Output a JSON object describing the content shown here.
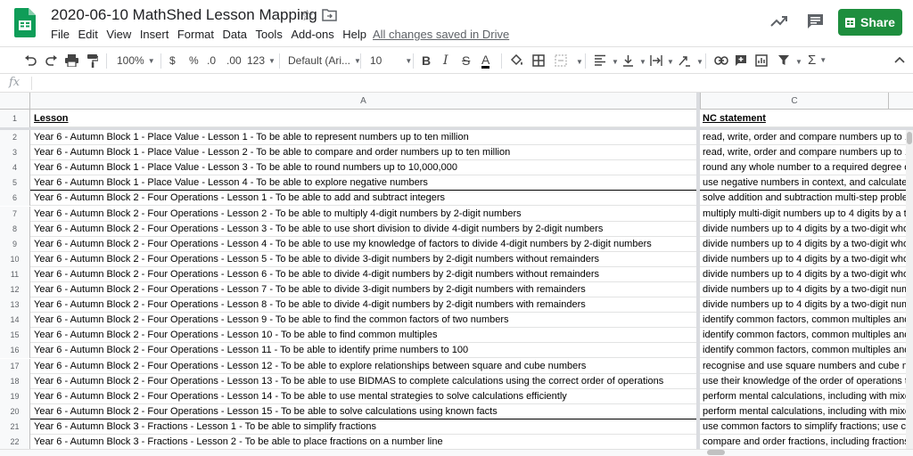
{
  "app": {
    "title": "2020-06-10 MathShed Lesson Mapping",
    "save_status": "All changes saved in Drive",
    "share_label": "Share",
    "brand_color": "#1e8e3e",
    "sheets_green": "#0f9d58"
  },
  "menu": [
    "File",
    "Edit",
    "View",
    "Insert",
    "Format",
    "Data",
    "Tools",
    "Add-ons",
    "Help"
  ],
  "toolbar": {
    "zoom": "100%",
    "currency": "$",
    "percent": "%",
    "dec_decrease": ".0",
    "dec_increase": ".00",
    "more_formats": "123",
    "font": "Default (Ari...",
    "font_size": "10",
    "bold": "B",
    "italic": "I",
    "strike": "S",
    "text_color": "A",
    "functions": "Σ"
  },
  "formula_bar": {
    "fx": "fx",
    "value": ""
  },
  "columns": {
    "a": "A",
    "c": "C"
  },
  "header": {
    "row": "1",
    "lesson": "Lesson",
    "nc": "NC statement"
  },
  "rows": [
    {
      "n": "2",
      "a": "Year 6 - Autumn Block 1 - Place Value - Lesson 1 - To be able to represent numbers up to ten million",
      "c": "read, write, order and compare numbers up to 10"
    },
    {
      "n": "3",
      "a": "Year 6 - Autumn Block 1 - Place Value - Lesson 2 - To be able to compare and order numbers up to ten million",
      "c": "read, write, order and compare numbers up to 10"
    },
    {
      "n": "4",
      "a": "Year 6 - Autumn Block 1 - Place Value - Lesson 3 - To be able to round numbers up to 10,000,000",
      "c": "round any whole number to a required degree of"
    },
    {
      "n": "5",
      "a": "Year 6 - Autumn Block 1 - Place Value - Lesson 4 - To be able to explore negative numbers",
      "c": "use negative numbers in context, and calculate i"
    },
    {
      "n": "6",
      "a": "Year 6 - Autumn Block 2 - Four Operations - Lesson 1 - To be able to add and subtract integers",
      "c": "solve addition and subtraction multi-step problen"
    },
    {
      "n": "7",
      "a": "Year 6 - Autumn Block 2 - Four Operations - Lesson 2 - To be able to multiply 4-digit numbers by 2-digit numbers",
      "c": "multiply multi-digit numbers up to 4 digits by a tw"
    },
    {
      "n": "8",
      "a": "Year 6 - Autumn Block 2 - Four Operations - Lesson 3 - To be able to use short division to divide 4-digit numbers by 2-digit numbers",
      "c": "divide numbers up to 4 digits by a two-digit whol"
    },
    {
      "n": "9",
      "a": "Year 6 - Autumn Block 2 - Four Operations - Lesson 4 - To be able to use my knowledge of factors to divide 4-digit numbers by 2-digit numbers",
      "c": "divide numbers up to 4 digits by a two-digit whol"
    },
    {
      "n": "10",
      "a": "Year 6 - Autumn Block 2 - Four Operations - Lesson 5 - To be able to divide 3-digit numbers by 2-digit numbers without remainders",
      "c": "divide numbers up to 4 digits by a two-digit whol"
    },
    {
      "n": "11",
      "a": "Year 6 - Autumn Block 2 - Four Operations - Lesson 6 - To be able to divide 4-digit numbers by 2-digit numbers without remainders",
      "c": "divide numbers up to 4 digits by a two-digit whol"
    },
    {
      "n": "12",
      "a": "Year 6 - Autumn Block 2 - Four Operations - Lesson 7 - To be able to divide 3-digit numbers by 2-digit numbers with remainders",
      "c": "divide numbers up to 4 digits by a two-digit numb"
    },
    {
      "n": "13",
      "a": "Year 6 - Autumn Block 2 - Four Operations - Lesson 8 - To be able to divide 4-digit numbers by 2-digit numbers with remainders",
      "c": "divide numbers up to 4 digits by a two-digit numb"
    },
    {
      "n": "14",
      "a": "Year 6 - Autumn Block 2 - Four Operations - Lesson 9 - To be able to find the common factors of two numbers",
      "c": "identify common factors, common multiples and"
    },
    {
      "n": "15",
      "a": "Year 6 - Autumn Block 2 - Four Operations - Lesson 10 - To be able to find common multiples",
      "c": "identify common factors, common multiples and"
    },
    {
      "n": "16",
      "a": "Year 6 - Autumn Block 2 - Four Operations - Lesson 11 - To be able to identify prime numbers to 100",
      "c": "identify common factors, common multiples and"
    },
    {
      "n": "17",
      "a": "Year 6 - Autumn Block 2 - Four Operations - Lesson 12 - To be able to explore relationships between square and cube numbers",
      "c": "recognise and use square numbers and cube nu"
    },
    {
      "n": "18",
      "a": "Year 6 - Autumn Block 2 - Four Operations - Lesson 13 - To be able to use BIDMAS to complete calculations using the correct order of operations",
      "c": "use their knowledge of the order of operations to"
    },
    {
      "n": "19",
      "a": "Year 6 - Autumn Block 2 - Four Operations - Lesson 14 - To be able to use mental strategies to solve calculations efficiently",
      "c": "perform mental calculations, including with mixe"
    },
    {
      "n": "20",
      "a": "Year 6 - Autumn Block 2 - Four Operations - Lesson 15 - To be able to solve calculations using known facts",
      "c": "perform mental calculations, including with mixe"
    },
    {
      "n": "21",
      "a": "Year 6 - Autumn Block 3 - Fractions - Lesson 1 - To be able to simplify fractions",
      "c": "use common factors to simplify fractions; use co"
    },
    {
      "n": "22",
      "a": "Year 6 - Autumn Block 3 - Fractions - Lesson 2 - To be able to place fractions on a number line",
      "c": "compare and order fractions, including fractions"
    }
  ]
}
